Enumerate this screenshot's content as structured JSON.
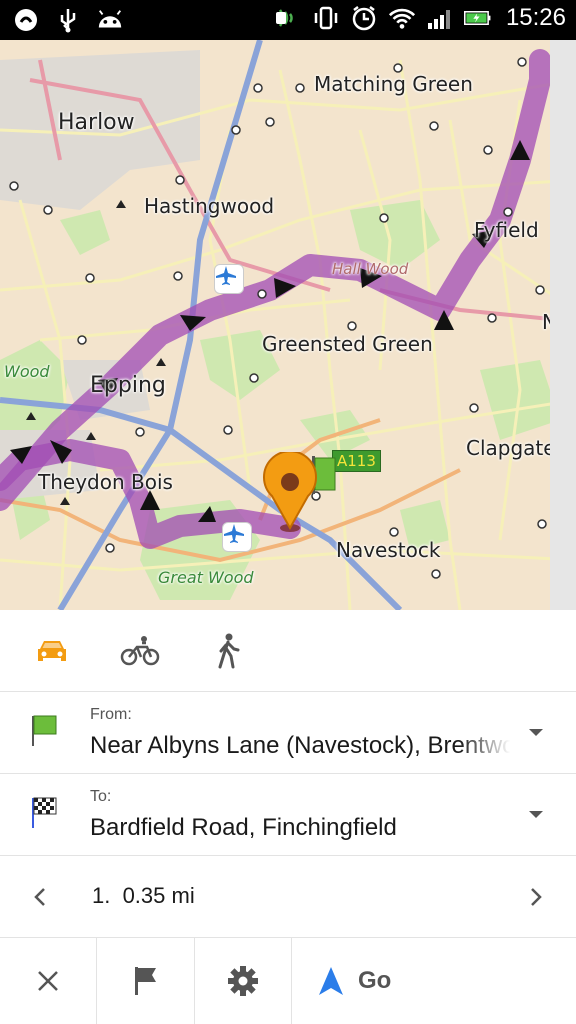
{
  "status_bar": {
    "time": "15:26",
    "icons": [
      "notification-icon",
      "usb-icon",
      "android-debug-icon",
      "nfc-icon",
      "vibrate-icon",
      "alarm-icon",
      "wifi-icon",
      "signal-icon",
      "battery-charging-icon"
    ]
  },
  "map": {
    "labels": {
      "matching_green": "Matching Green",
      "harlow": "Harlow",
      "hastingwood": "Hastingwood",
      "epping": "Epping",
      "theydon_bois": "Theydon Bois",
      "greensted_green": "Greensted Green",
      "navestock": "Navestock",
      "clapgate": "Clapgate",
      "fyfield": "Fyfield",
      "hall_wood": "Hall Wood",
      "wood": "Wood",
      "great_wood": "Great Wood",
      "edge_n": "N"
    },
    "road_badge": "A113",
    "colors": {
      "route": "#a14cb4",
      "pin": "#f39c12",
      "land": "#f3e4cd",
      "green": "#cfe8b0"
    }
  },
  "modes": [
    {
      "name": "car",
      "active": true,
      "color": "#f39c12"
    },
    {
      "name": "bicycle",
      "active": false
    },
    {
      "name": "pedestrian",
      "active": false
    }
  ],
  "from": {
    "label": "From:",
    "value": "Near Albyns Lane (Navestock), Brentwood"
  },
  "to": {
    "label": "To:",
    "value": "Bardfield Road, Finchingfield"
  },
  "step": {
    "text": "1.  0.35 mi"
  },
  "actions": {
    "go_label": "Go",
    "go_color": "#2b7de9"
  }
}
